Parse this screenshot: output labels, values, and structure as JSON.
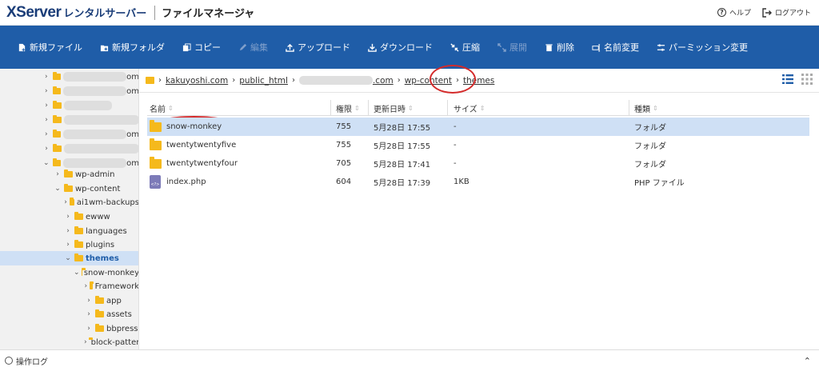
{
  "header": {
    "logo": "XServer",
    "logo_sub": "レンタルサーバー",
    "app_name": "ファイルマネージャ",
    "help_label": "ヘルプ",
    "logout_label": "ログアウト"
  },
  "toolbar": {
    "new_file": "新規ファイル",
    "new_folder": "新規フォルダ",
    "copy": "コピー",
    "edit": "編集",
    "upload": "アップロード",
    "download": "ダウンロード",
    "compress": "圧縮",
    "extract": "展開",
    "delete": "削除",
    "rename": "名前変更",
    "permission": "パーミッション変更"
  },
  "sidebar": {
    "blurred_suffix": "om",
    "items": [
      {
        "label": "wp-admin",
        "expanded": false
      },
      {
        "label": "wp-content",
        "expanded": true
      },
      {
        "label": "ai1wm-backups",
        "expanded": false
      },
      {
        "label": "ewww",
        "expanded": false
      },
      {
        "label": "languages",
        "expanded": false
      },
      {
        "label": "plugins",
        "expanded": false
      },
      {
        "label": "themes",
        "expanded": true,
        "selected": true
      },
      {
        "label": "snow-monkey",
        "expanded": true
      },
      {
        "label": "Framework",
        "expanded": false
      },
      {
        "label": "app",
        "expanded": false
      },
      {
        "label": "assets",
        "expanded": false
      },
      {
        "label": "bbpress",
        "expanded": false
      },
      {
        "label": "block-patterns",
        "expanded": false
      }
    ]
  },
  "breadcrumb": {
    "items": [
      "kakuyoshi.com",
      "public_html",
      ".com",
      "wp-content",
      "themes"
    ]
  },
  "table": {
    "headers": {
      "name": "名前",
      "perm": "権限",
      "date": "更新日時",
      "size": "サイズ",
      "type": "種類"
    },
    "rows": [
      {
        "name": "snow-monkey",
        "perm": "755",
        "date": "5月28日 17:55",
        "size": "-",
        "type": "フォルダ",
        "icon": "folder-icon",
        "selected": true
      },
      {
        "name": "twentytwentyfive",
        "perm": "755",
        "date": "5月28日 17:55",
        "size": "-",
        "type": "フォルダ",
        "icon": "folder-icon"
      },
      {
        "name": "twentytwentyfour",
        "perm": "705",
        "date": "5月28日 17:41",
        "size": "-",
        "type": "フォルダ",
        "icon": "folder-icon"
      },
      {
        "name": "index.php",
        "perm": "604",
        "date": "5月28日 17:39",
        "size": "1KB",
        "type": "PHP ファイル",
        "icon": "php-file-icon"
      }
    ]
  },
  "footer": {
    "log_label": "操作ログ"
  },
  "colors": {
    "toolbar_bg": "#1f5da8",
    "brand": "#1a3d78",
    "folder": "#f5b91c",
    "selection": "#cfe0f5",
    "annotation_ring": "#d42a2a"
  }
}
